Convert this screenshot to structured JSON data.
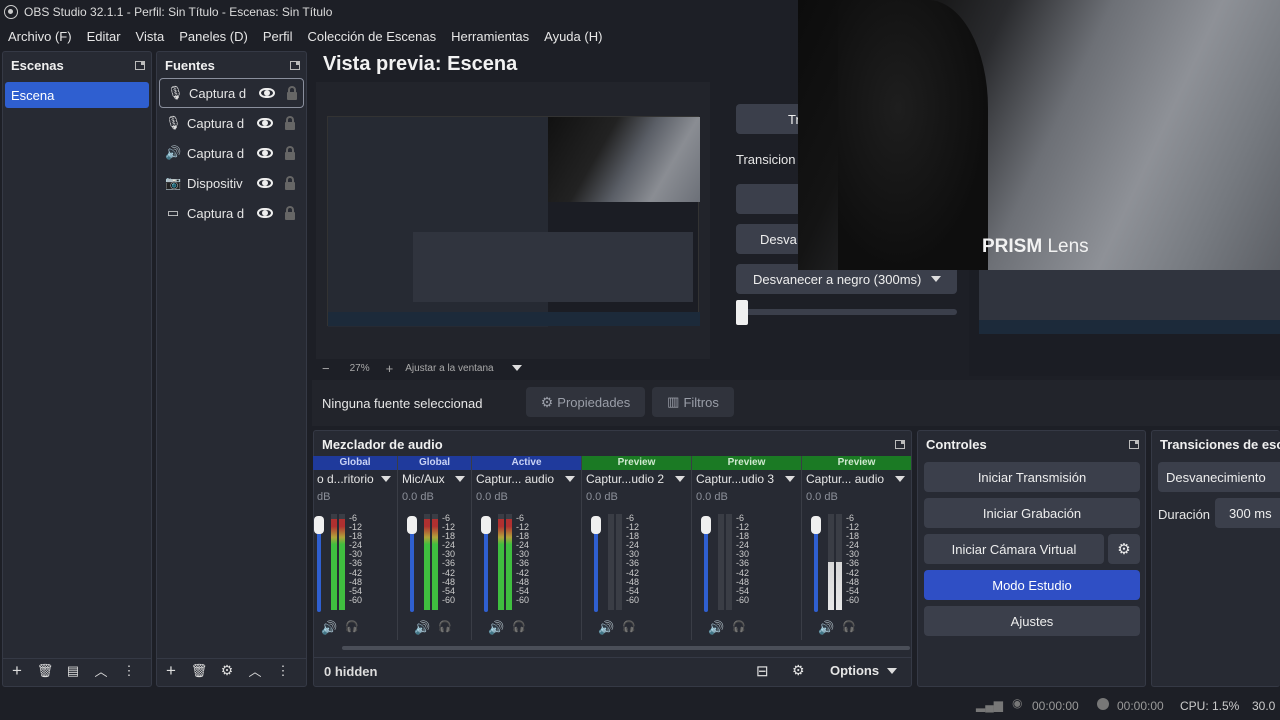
{
  "window": {
    "title": "OBS Studio 32.1.1 - Perfil: Sin Título - Escenas: Sin Título"
  },
  "menu": [
    "Archivo (F)",
    "Editar",
    "Vista",
    "Paneles (D)",
    "Perfil",
    "Colección de Escenas",
    "Herramientas",
    "Ayuda (H)"
  ],
  "scenes": {
    "title": "Escenas",
    "items": [
      "Escena"
    ]
  },
  "sources": {
    "title": "Fuentes",
    "items": [
      {
        "label": "Captura d",
        "icon": "microphone-icon"
      },
      {
        "label": "Captura d",
        "icon": "microphone-icon"
      },
      {
        "label": "Captura d",
        "icon": "speaker-icon"
      },
      {
        "label": "Dispositiv",
        "icon": "camera-icon"
      },
      {
        "label": "Captura d",
        "icon": "monitor-icon"
      }
    ]
  },
  "preview": {
    "title": "Vista previa: Escena",
    "zoom": "27%",
    "fit_label": "Ajustar a la ventana",
    "minus": "−",
    "plus": "+"
  },
  "transitions_mid": {
    "btn_top": "Tr",
    "label": "Transicion",
    "btn_fade": "Desva",
    "dropdown": "Desvanecer a negro (300ms)"
  },
  "overlay": {
    "brand_bold": "PRISM",
    "brand_light": "Lens"
  },
  "source_toolbar": {
    "no_selection": "Ninguna fuente seleccionad",
    "properties": "Propiedades",
    "filters": "Filtros"
  },
  "mixer": {
    "title": "Mezclador de audio",
    "hidden": "0 hidden",
    "options": "Options",
    "scale_labels": [
      "-6",
      "-12",
      "-18",
      "-24",
      "-30",
      "-36",
      "-42",
      "-48",
      "-54",
      "-60"
    ],
    "channels": [
      {
        "header": "Global",
        "header_color": "#1f3a9c",
        "name": "o d...ritorio",
        "db": "dB",
        "level": 0.95
      },
      {
        "header": "Global",
        "header_color": "#1f3a9c",
        "name": "Mic/Aux",
        "db": "0.0 dB",
        "level": 0.95
      },
      {
        "header": "Active",
        "header_color": "#1f3a9c",
        "name": "Captur... audio",
        "db": "0.0 dB",
        "level": 0.95
      },
      {
        "header": "Preview",
        "header_color": "#1b7a24",
        "name": "Captur...udio 2",
        "db": "0.0 dB",
        "level": 0.0
      },
      {
        "header": "Preview",
        "header_color": "#1b7a24",
        "name": "Captur...udio 3",
        "db": "0.0 dB",
        "level": 0.0
      },
      {
        "header": "Preview",
        "header_color": "#1b7a24",
        "name": "Captur... audio",
        "db": "0.0 dB",
        "level": 0.5
      }
    ]
  },
  "controls": {
    "title": "Controles",
    "stream": "Iniciar Transmisión",
    "record": "Iniciar Grabación",
    "virtual_cam": "Iniciar Cámara Virtual",
    "studio": "Modo Estudio",
    "settings": "Ajustes"
  },
  "scene_transitions": {
    "title": "Transiciones de esc",
    "selected": "Desvanecimiento",
    "duration_label": "Duración",
    "duration_value": "300 ms"
  },
  "status": {
    "stream_time": "00:00:00",
    "rec_time": "00:00:00",
    "cpu": "CPU: 1.5%",
    "fps": "30.0"
  }
}
